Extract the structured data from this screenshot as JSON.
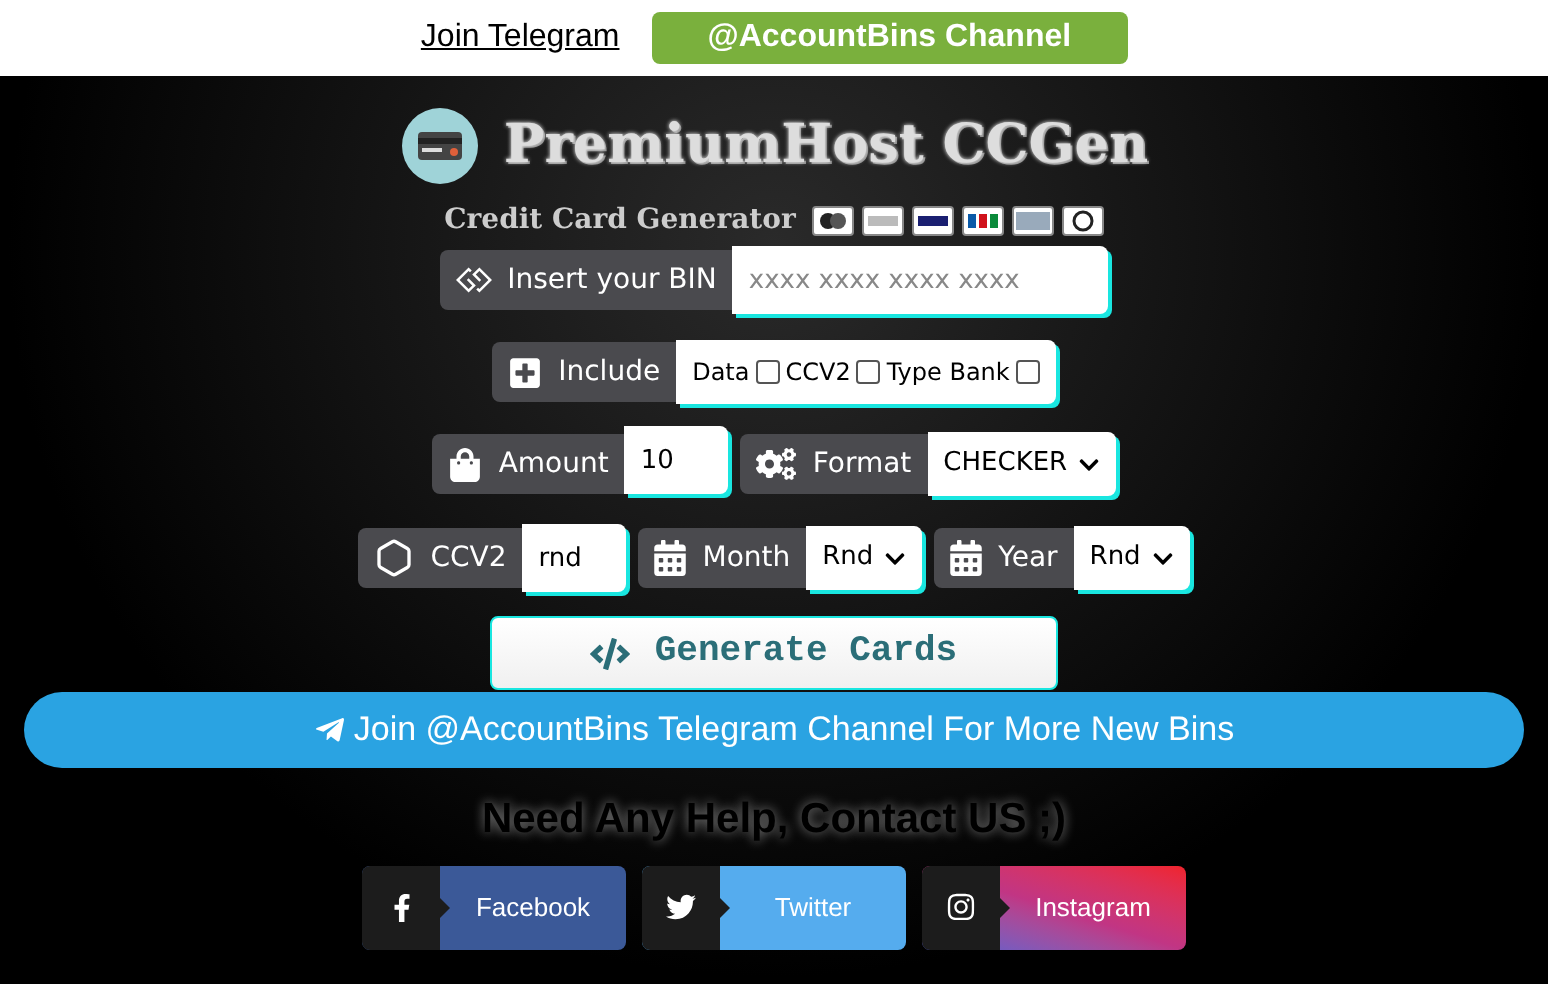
{
  "top_bar": {
    "link": "Join Telegram",
    "channel_button": "@AccountBins Channel"
  },
  "title": "PremiumHost CCGen",
  "subtitle": "Credit Card Generator",
  "bin": {
    "label": "Insert your BIN",
    "placeholder": "xxxx xxxx xxxx xxxx"
  },
  "include": {
    "label": "Include",
    "options": [
      {
        "label": "Data",
        "checked": false
      },
      {
        "label": "CCV2",
        "checked": false
      },
      {
        "label": "Type Bank",
        "checked": false
      }
    ]
  },
  "amount": {
    "label": "Amount",
    "value": "10"
  },
  "format": {
    "label": "Format",
    "value": "CHECKER"
  },
  "ccv2": {
    "label": "CCV2",
    "value": "rnd"
  },
  "month": {
    "label": "Month",
    "value": "Rnd"
  },
  "year": {
    "label": "Year",
    "value": "Rnd"
  },
  "generate_button": "Generate Cards",
  "telegram_banner": "Join @AccountBins Telegram Channel For More New Bins",
  "help_text": "Need Any Help, Contact US ;)",
  "social": [
    {
      "kind": "facebook",
      "label": "Facebook"
    },
    {
      "kind": "twitter",
      "label": "Twitter"
    },
    {
      "kind": "instagram",
      "label": "Instagram"
    }
  ]
}
